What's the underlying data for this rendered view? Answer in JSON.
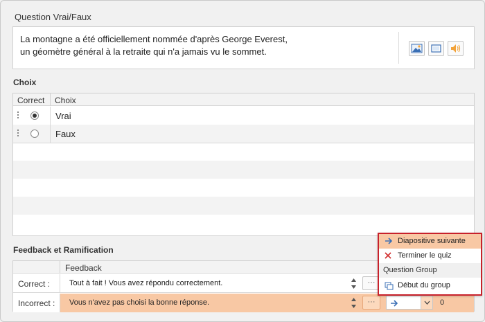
{
  "title": "Question Vrai/Faux",
  "question": {
    "line1": "La montagne a été officiellement nommée d'après George Everest,",
    "line2": "un géomètre général à la retraite qui n'a jamais vu le sommet.",
    "media_buttons": [
      "image-icon",
      "video-icon",
      "audio-icon"
    ]
  },
  "choices_section": {
    "label": "Choix",
    "col_correct": "Correct",
    "col_choice": "Choix",
    "rows": [
      {
        "text": "Vrai",
        "selected": true
      },
      {
        "text": "Faux",
        "selected": false
      }
    ]
  },
  "feedback_section": {
    "label": "Feedback et Ramification",
    "col_feedback": "Feedback",
    "rows": [
      {
        "label": "Correct :",
        "text": "Tout à fait ! Vous avez répondu correctement.",
        "dots": "···"
      },
      {
        "label": "Incorrect :",
        "text": "Vous n'avez pas choisi la bonne réponse.",
        "dots": "···",
        "branch_value": "0"
      }
    ]
  },
  "branch_menu": {
    "items": [
      {
        "label": "Diapositive suivante",
        "icon": "arrow-right-icon"
      },
      {
        "label": "Terminer le quiz",
        "icon": "close-icon"
      }
    ],
    "group_label": "Question Group",
    "group_items": [
      {
        "label": "Début du group",
        "icon": "group-icon"
      }
    ]
  },
  "colors": {
    "highlight": "#f8c8a4",
    "menu_border": "#c8212b",
    "arrow": "#3a6fb5",
    "close": "#d23030"
  }
}
